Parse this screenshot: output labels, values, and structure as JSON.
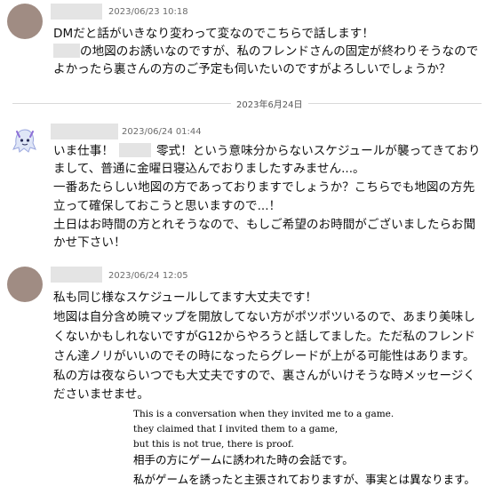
{
  "messages": [
    {
      "timestamp": "2023/06/23 10:18",
      "lines": [
        "DMだと話がいきなり変わって変なのでこちらで話します！",
        "の地図のお誘いなのですが、私のフレンドさんの固定が終わりそうなので",
        "よかったら裏さんの方のご予定も伺いたいのですがよろしいでしょうか？"
      ]
    },
    {
      "timestamp": "2023/06/24 01:44",
      "lines_a": [
        "いま仕事！",
        "零式！という意味分からないスケジュールが襲ってきており"
      ],
      "lines": [
        "まして、普通に金曜日寝込んでおりましたすみません...。",
        "一番あたらしい地図の方であっておりますでしょうか？こちらでも地図の方先",
        "立って確保しておこうと思いますので...！",
        "土日はお時間の方とれそうなので、もしご希望のお時間がございましたらお聞",
        "かせ下さい！"
      ]
    },
    {
      "timestamp": "2023/06/24 12:05",
      "lines": [
        "私も同じ様なスケジュールしてます大丈夫です！",
        "地図は自分含め暁マップを開放してない方がポツポツいるので、あまり美味し",
        "くないかもしれないですがG12からやろうと話してました。ただ私のフレンド",
        "さん達ノリがいいのでその時になったらグレードが上がる可能性はあります。",
        "私の方は夜ならいつでも大丈夫ですので、裏さんがいけそうな時メッセージく",
        "ださいませませ。"
      ]
    }
  ],
  "date_divider": "2023年6月24日",
  "annotation": {
    "english": [
      "This is a conversation when they invited me to a game.",
      "they claimed that I invited them to a game,",
      "but this is not true, there is proof."
    ],
    "japanese": [
      "相手の方にゲームに誘われた時の会話です。",
      "私がゲームを誘ったと主張されておりますが、事実とは異なります。"
    ]
  }
}
